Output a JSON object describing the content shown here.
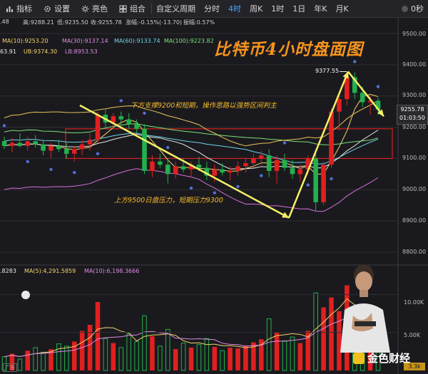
{
  "toolbar": {
    "items": [
      {
        "icon": "bar-chart-icon",
        "label": "指标"
      },
      {
        "icon": "gear-icon",
        "label": "设置"
      },
      {
        "icon": "sun-icon",
        "label": "亮色"
      },
      {
        "icon": "grid-icon",
        "label": "组合"
      }
    ],
    "custom_period_label": "自定义周期",
    "periods": [
      "分时",
      "4时",
      "周K",
      "1时",
      "1日",
      "年K",
      "月K"
    ],
    "active_period": "4时",
    "timer": "0秒"
  },
  "info": {
    "first": ".48",
    "high": "高:9288.21",
    "low": "低:9235.50",
    "close": "收:9255.78",
    "change": "涨幅:-0.15%(-13.70)",
    "amplitude": "振幅:0.57%"
  },
  "ma_row": {
    "ma10": "MA(10):9253.20",
    "ma30": "MA(30):9137.14",
    "ma60": "MA(60):9133.74",
    "ma100": "MA(100):9223.82"
  },
  "boll_row": {
    "mid": "63.91",
    "ub": "UB:9374.30",
    "lb": "LB:8953.53"
  },
  "vol_row": {
    "vol": ".8283",
    "ma5": "MA(5):4,291.5859",
    "ma10": "MA(10):6,198.3666"
  },
  "chart_title": "比特币4小时盘面图",
  "annotations": {
    "support": "下方支撑9200和短期，操作思路以强势区间判主",
    "resistance": "上方9500日盘压力，短期压力9300",
    "peak_label": "9377.55"
  },
  "current_price": {
    "price": "9255.78",
    "countdown": "01:03:50"
  },
  "y_ticks": [
    "9500.00",
    "9400.00",
    "9300.00",
    "9200.00",
    "9100.00",
    "9000.00",
    "8900.00",
    "8800.00"
  ],
  "vol_ticks": [
    "10.00K",
    "5.00K"
  ],
  "vol_tag": "3.3k",
  "ad_label": "广告",
  "logo_text": "金色财经",
  "colors": {
    "up": "#e02020",
    "down": "#22b14c",
    "annotation": "#f7b928",
    "title": "#f7941d",
    "arrow": "#f5f067"
  },
  "chart_data": {
    "type": "candlestick",
    "title": "比特币4小时盘面图",
    "period": "4时",
    "ylim": [
      8750,
      9580
    ],
    "y_ticks": [
      8800,
      8900,
      9000,
      9100,
      9200,
      9300,
      9400,
      9500
    ],
    "candles": [
      {
        "o": 9155,
        "h": 9170,
        "l": 9130,
        "c": 9140
      },
      {
        "o": 9140,
        "h": 9165,
        "l": 9120,
        "c": 9150
      },
      {
        "o": 9150,
        "h": 9180,
        "l": 9135,
        "c": 9140
      },
      {
        "o": 9140,
        "h": 9170,
        "l": 9125,
        "c": 9155
      },
      {
        "o": 9155,
        "h": 9175,
        "l": 9135,
        "c": 9145
      },
      {
        "o": 9145,
        "h": 9160,
        "l": 9110,
        "c": 9125
      },
      {
        "o": 9125,
        "h": 9150,
        "l": 9100,
        "c": 9140
      },
      {
        "o": 9140,
        "h": 9160,
        "l": 9120,
        "c": 9130
      },
      {
        "o": 9130,
        "h": 9150,
        "l": 9100,
        "c": 9115
      },
      {
        "o": 9115,
        "h": 9140,
        "l": 9090,
        "c": 9130
      },
      {
        "o": 9130,
        "h": 9160,
        "l": 9110,
        "c": 9145
      },
      {
        "o": 9145,
        "h": 9180,
        "l": 9125,
        "c": 9160
      },
      {
        "o": 9160,
        "h": 9250,
        "l": 9150,
        "c": 9240
      },
      {
        "o": 9240,
        "h": 9260,
        "l": 9200,
        "c": 9215
      },
      {
        "o": 9215,
        "h": 9245,
        "l": 9195,
        "c": 9235
      },
      {
        "o": 9235,
        "h": 9250,
        "l": 9205,
        "c": 9225
      },
      {
        "o": 9225,
        "h": 9245,
        "l": 9195,
        "c": 9210
      },
      {
        "o": 9210,
        "h": 9225,
        "l": 9180,
        "c": 9195
      },
      {
        "o": 9195,
        "h": 9210,
        "l": 9050,
        "c": 9060
      },
      {
        "o": 9060,
        "h": 9110,
        "l": 9040,
        "c": 9090
      },
      {
        "o": 9090,
        "h": 9115,
        "l": 9070,
        "c": 9080
      },
      {
        "o": 9080,
        "h": 9100,
        "l": 9020,
        "c": 9050
      },
      {
        "o": 9050,
        "h": 9090,
        "l": 9035,
        "c": 9075
      },
      {
        "o": 9075,
        "h": 9100,
        "l": 9055,
        "c": 9065
      },
      {
        "o": 9065,
        "h": 9090,
        "l": 9040,
        "c": 9080
      },
      {
        "o": 9080,
        "h": 9105,
        "l": 9060,
        "c": 9070
      },
      {
        "o": 9070,
        "h": 9090,
        "l": 9030,
        "c": 9045
      },
      {
        "o": 9045,
        "h": 9080,
        "l": 9025,
        "c": 9065
      },
      {
        "o": 9065,
        "h": 9085,
        "l": 9045,
        "c": 9055
      },
      {
        "o": 9055,
        "h": 9075,
        "l": 9030,
        "c": 9060
      },
      {
        "o": 9060,
        "h": 9090,
        "l": 9045,
        "c": 9075
      },
      {
        "o": 9075,
        "h": 9100,
        "l": 9055,
        "c": 9085
      },
      {
        "o": 9085,
        "h": 9115,
        "l": 9070,
        "c": 9100
      },
      {
        "o": 9100,
        "h": 9125,
        "l": 9080,
        "c": 9110
      },
      {
        "o": 9110,
        "h": 9130,
        "l": 9040,
        "c": 9060
      },
      {
        "o": 9060,
        "h": 9110,
        "l": 9020,
        "c": 9095
      },
      {
        "o": 9095,
        "h": 9115,
        "l": 9060,
        "c": 9070
      },
      {
        "o": 9070,
        "h": 9095,
        "l": 9035,
        "c": 9050
      },
      {
        "o": 9050,
        "h": 9080,
        "l": 9025,
        "c": 9065
      },
      {
        "o": 9065,
        "h": 9110,
        "l": 9050,
        "c": 9100
      },
      {
        "o": 9100,
        "h": 9120,
        "l": 8930,
        "c": 8960
      },
      {
        "o": 8960,
        "h": 9090,
        "l": 8950,
        "c": 9080
      },
      {
        "o": 9080,
        "h": 9260,
        "l": 9070,
        "c": 9250
      },
      {
        "o": 9250,
        "h": 9300,
        "l": 9190,
        "c": 9290
      },
      {
        "o": 9290,
        "h": 9378,
        "l": 9270,
        "c": 9360
      },
      {
        "o": 9360,
        "h": 9375,
        "l": 9290,
        "c": 9310
      },
      {
        "o": 9310,
        "h": 9330,
        "l": 9265,
        "c": 9280
      },
      {
        "o": 9280,
        "h": 9300,
        "l": 9240,
        "c": 9285
      },
      {
        "o": 9285,
        "h": 9295,
        "l": 9240,
        "c": 9256
      }
    ],
    "volumes": [
      1800,
      2200,
      1500,
      2600,
      3000,
      2400,
      2800,
      3500,
      3200,
      3800,
      5200,
      6000,
      9000,
      4200,
      3600,
      3000,
      4800,
      3800,
      7200,
      4500,
      3200,
      5400,
      2800,
      3600,
      3000,
      3400,
      4200,
      3100,
      2600,
      3000,
      2900,
      3300,
      3700,
      4100,
      6800,
      5000,
      3900,
      4400,
      3600,
      5200,
      10200,
      8300,
      9600,
      7800,
      11200,
      6300,
      5400,
      4600,
      3300
    ]
  }
}
